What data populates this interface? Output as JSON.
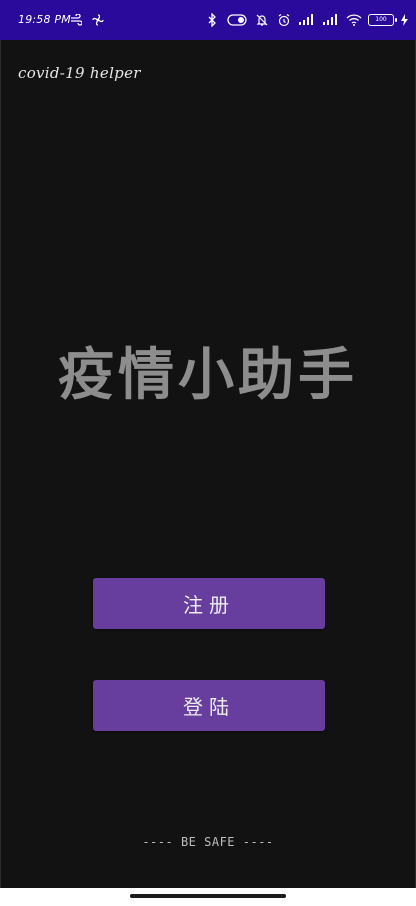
{
  "status_bar": {
    "time": "19:58 PM",
    "battery_level": "100",
    "icons_left": [
      "wind-icon",
      "fan-icon"
    ],
    "icons_right": [
      "bluetooth-icon",
      "toggle-icon",
      "muted-bell-icon",
      "alarm-icon",
      "signal-icon",
      "signal-icon",
      "wifi-icon",
      "battery-icon",
      "charging-icon"
    ]
  },
  "app_bar": {
    "title": "covid-19 helper"
  },
  "main": {
    "headline": "疫情小助手",
    "register_button": "注册",
    "login_button": "登陆",
    "footer": "---- BE SAFE ----"
  },
  "colors": {
    "status_bar_bg": "#2a0a9a",
    "background": "#121212",
    "button_bg": "#673e9e",
    "headline": "#8d8d8d"
  }
}
